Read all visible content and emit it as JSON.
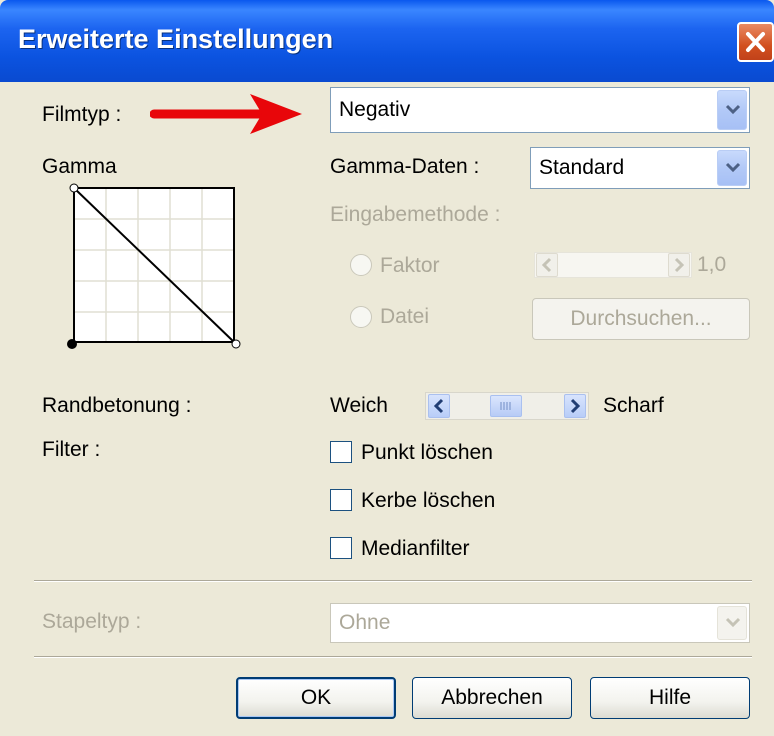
{
  "window": {
    "title": "Erweiterte Einstellungen"
  },
  "filmtyp": {
    "label": "Filmtyp :",
    "value": "Negativ"
  },
  "gamma": {
    "label": "Gamma",
    "data_label": "Gamma-Daten :",
    "data_value": "Standard",
    "input_method_label": "Eingabemethode :",
    "faktor_label": "Faktor",
    "faktor_value": "1,0",
    "datei_label": "Datei",
    "browse_label": "Durchsuchen..."
  },
  "randbetonung": {
    "label": "Randbetonung :",
    "left": "Weich",
    "right": "Scharf"
  },
  "filter": {
    "label": "Filter :",
    "options": [
      {
        "label": "Punkt löschen",
        "checked": false
      },
      {
        "label": "Kerbe löschen",
        "checked": false
      },
      {
        "label": "Medianfilter",
        "checked": false
      }
    ]
  },
  "stapeltyp": {
    "label": "Stapeltyp :",
    "value": "Ohne"
  },
  "buttons": {
    "ok": "OK",
    "cancel": "Abbrechen",
    "help": "Hilfe"
  },
  "colors": {
    "title_bar": "#0a4ad0",
    "annotation_arrow": "#e8060a",
    "dialog_bg": "#ece9d8"
  }
}
